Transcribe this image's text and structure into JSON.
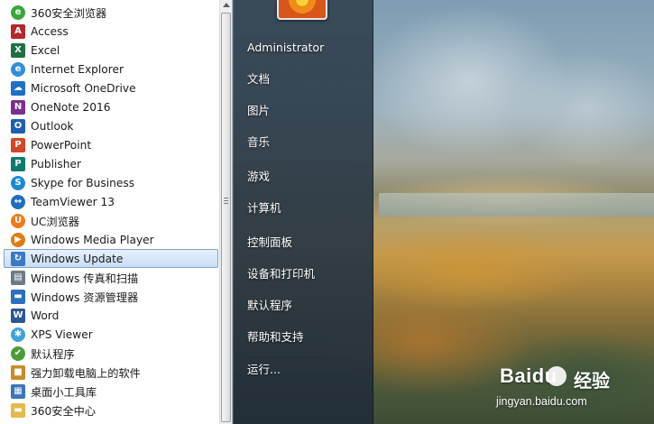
{
  "programs": [
    {
      "label": "360安全浏览器",
      "icon": "browser-360-icon",
      "glyph": "e",
      "color": "#3aa63a",
      "round": true,
      "selected": false
    },
    {
      "label": "Access",
      "icon": "access-icon",
      "glyph": "A",
      "color": "#b3282d",
      "round": false,
      "selected": false
    },
    {
      "label": "Excel",
      "icon": "excel-icon",
      "glyph": "X",
      "color": "#1d7044",
      "round": false,
      "selected": false
    },
    {
      "label": "Internet Explorer",
      "icon": "internet-explorer-icon",
      "glyph": "e",
      "color": "#2f8fd8",
      "round": true,
      "selected": false
    },
    {
      "label": "Microsoft OneDrive",
      "icon": "onedrive-icon",
      "glyph": "☁",
      "color": "#1e70c8",
      "round": false,
      "selected": false
    },
    {
      "label": "OneNote 2016",
      "icon": "onenote-icon",
      "glyph": "N",
      "color": "#7a2e8f",
      "round": false,
      "selected": false
    },
    {
      "label": "Outlook",
      "icon": "outlook-icon",
      "glyph": "O",
      "color": "#1f5fae",
      "round": false,
      "selected": false
    },
    {
      "label": "PowerPoint",
      "icon": "powerpoint-icon",
      "glyph": "P",
      "color": "#d24726",
      "round": false,
      "selected": false
    },
    {
      "label": "Publisher",
      "icon": "publisher-icon",
      "glyph": "P",
      "color": "#107a6e",
      "round": false,
      "selected": false
    },
    {
      "label": "Skype for Business",
      "icon": "skype-icon",
      "glyph": "S",
      "color": "#1c8ad6",
      "round": true,
      "selected": false
    },
    {
      "label": "TeamViewer 13",
      "icon": "teamviewer-icon",
      "glyph": "↔",
      "color": "#1b6fc2",
      "round": true,
      "selected": false
    },
    {
      "label": "UC浏览器",
      "icon": "uc-browser-icon",
      "glyph": "U",
      "color": "#f07a18",
      "round": true,
      "selected": false
    },
    {
      "label": "Windows Media Player",
      "icon": "media-player-icon",
      "glyph": "▶",
      "color": "#e07b12",
      "round": true,
      "selected": false
    },
    {
      "label": "Windows Update",
      "icon": "windows-update-icon",
      "glyph": "↻",
      "color": "#3b78c8",
      "round": false,
      "selected": true
    },
    {
      "label": "Windows 传真和扫描",
      "icon": "fax-scan-icon",
      "glyph": "▤",
      "color": "#6d7b88",
      "round": false,
      "selected": false
    },
    {
      "label": "Windows 资源管理器",
      "icon": "explorer-folder-icon",
      "glyph": "▬",
      "color": "#2a70bf",
      "round": false,
      "selected": false
    },
    {
      "label": "Word",
      "icon": "word-icon",
      "glyph": "W",
      "color": "#2b5797",
      "round": false,
      "selected": false
    },
    {
      "label": "XPS Viewer",
      "icon": "xps-viewer-icon",
      "glyph": "✱",
      "color": "#3fa3d6",
      "round": true,
      "selected": false
    },
    {
      "label": "默认程序",
      "icon": "default-programs-icon",
      "glyph": "✔",
      "color": "#4d9a3a",
      "round": true,
      "selected": false
    },
    {
      "label": "强力卸载电脑上的软件",
      "icon": "uninstall-tool-icon",
      "glyph": "■",
      "color": "#c98a2a",
      "round": false,
      "selected": false
    },
    {
      "label": "桌面小工具库",
      "icon": "gadgets-icon",
      "glyph": "▦",
      "color": "#3975b8",
      "round": false,
      "selected": false
    },
    {
      "label": "360安全中心",
      "icon": "folder-icon",
      "glyph": "▬",
      "color": "#e7b94a",
      "round": false,
      "selected": false
    }
  ],
  "right_panel": {
    "user": "Administrator",
    "items": [
      "文档",
      "图片",
      "音乐",
      "游戏",
      "计算机",
      "控制面板",
      "设备和打印机",
      "默认程序",
      "帮助和支持",
      "运行..."
    ]
  },
  "watermark": {
    "logo": "Baidu",
    "jingyan": "经验",
    "url": "jingyan.baidu.com"
  }
}
